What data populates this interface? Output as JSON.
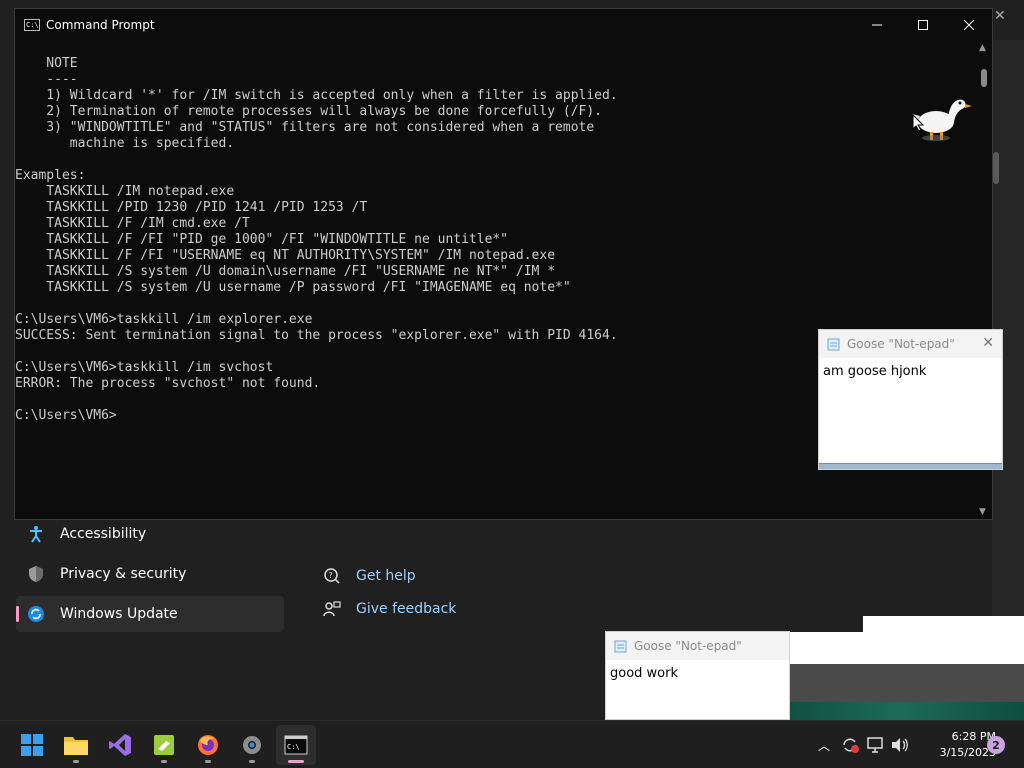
{
  "settings": {
    "nav": [
      {
        "label": "Accessibility",
        "icon": "accessibility-icon"
      },
      {
        "label": "Privacy & security",
        "icon": "shield-icon"
      },
      {
        "label": "Windows Update",
        "icon": "windows-update-icon",
        "selected": true
      }
    ],
    "links": [
      {
        "label": "Get help",
        "icon": "help-icon"
      },
      {
        "label": "Give feedback",
        "icon": "feedback-icon"
      }
    ],
    "accent_color": "#ff99c8"
  },
  "cmd": {
    "title": "Command Prompt",
    "lines": [
      "    NOTE",
      "    ----",
      "    1) Wildcard '*' for /IM switch is accepted only when a filter is applied.",
      "    2) Termination of remote processes will always be done forcefully (/F).",
      "    3) \"WINDOWTITLE\" and \"STATUS\" filters are not considered when a remote",
      "       machine is specified.",
      "",
      "Examples:",
      "    TASKKILL /IM notepad.exe",
      "    TASKKILL /PID 1230 /PID 1241 /PID 1253 /T",
      "    TASKKILL /F /IM cmd.exe /T",
      "    TASKKILL /F /FI \"PID ge 1000\" /FI \"WINDOWTITLE ne untitle*\"",
      "    TASKKILL /F /FI \"USERNAME eq NT AUTHORITY\\SYSTEM\" /IM notepad.exe",
      "    TASKKILL /S system /U domain\\username /FI \"USERNAME ne NT*\" /IM *",
      "    TASKKILL /S system /U username /P password /FI \"IMAGENAME eq note*\"",
      "",
      "C:\\Users\\VM6>taskkill /im explorer.exe",
      "SUCCESS: Sent termination signal to the process \"explorer.exe\" with PID 4164.",
      "",
      "C:\\Users\\VM6>taskkill /im svchost",
      "ERROR: The process \"svchost\" not found.",
      "",
      "C:\\Users\\VM6>"
    ]
  },
  "notes": [
    {
      "title": "Goose \"Not-epad\"",
      "text": "am goose hjonk"
    },
    {
      "title": "Goose \"Not-epad\"",
      "text": "good work"
    }
  ],
  "taskbar": {
    "apps": [
      {
        "name": "start-button",
        "icon": "windows-logo-icon"
      },
      {
        "name": "file-explorer",
        "icon": "folder-icon"
      },
      {
        "name": "visual-studio",
        "icon": "visual-studio-icon"
      },
      {
        "name": "notepad-plus-plus",
        "icon": "notepad-plus-plus-icon"
      },
      {
        "name": "firefox",
        "icon": "firefox-icon"
      },
      {
        "name": "settings",
        "icon": "gear-icon"
      },
      {
        "name": "terminal",
        "icon": "terminal-icon",
        "active": true
      }
    ],
    "time": "6:28 PM",
    "date": "3/15/2023",
    "notification_count": "2"
  }
}
